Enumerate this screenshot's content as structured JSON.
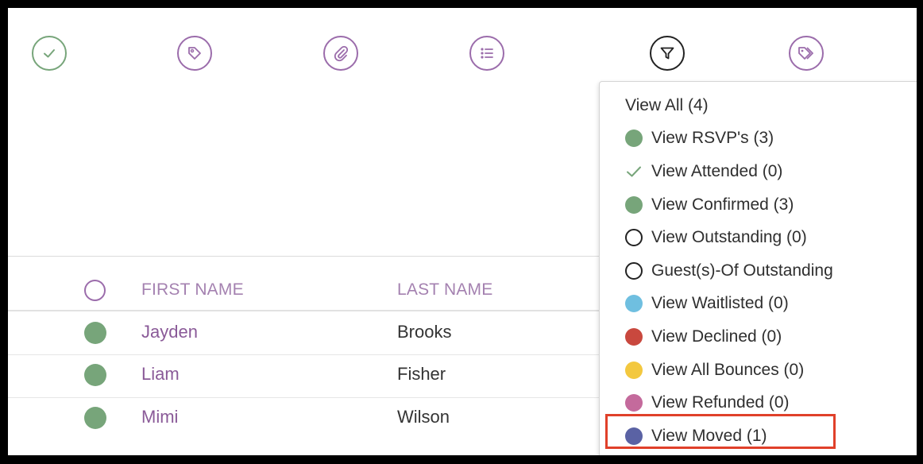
{
  "toolbar": {
    "icons": [
      {
        "name": "check-circle-icon",
        "color": "#77a57a"
      },
      {
        "name": "tag-icon",
        "color": "#9b6cab"
      },
      {
        "name": "paperclip-icon",
        "color": "#9b6cab"
      },
      {
        "name": "list-icon",
        "color": "#9b6cab"
      },
      {
        "name": "filter-icon",
        "color": "#222222"
      },
      {
        "name": "tags-icon",
        "color": "#9b6cab"
      }
    ]
  },
  "table": {
    "headers": {
      "first_name": "FIRST NAME",
      "last_name": "LAST NAME"
    },
    "rows": [
      {
        "first": "Jayden",
        "last": "Brooks",
        "status_color": "#77a57a"
      },
      {
        "first": "Liam",
        "last": "Fisher",
        "status_color": "#77a57a"
      },
      {
        "first": "Mimi",
        "last": "Wilson",
        "status_color": "#77a57a"
      }
    ]
  },
  "filter_menu": {
    "items": [
      {
        "label": "View All (4)",
        "marker": "none"
      },
      {
        "label": "View RSVP's (3)",
        "marker": "dot",
        "color": "#77a57a"
      },
      {
        "label": "View Attended (0)",
        "marker": "check",
        "color": "#77a57a"
      },
      {
        "label": "View Confirmed (3)",
        "marker": "dot",
        "color": "#77a57a"
      },
      {
        "label": "View Outstanding (0)",
        "marker": "open-circle"
      },
      {
        "label": "Guest(s)-Of Outstanding",
        "marker": "open-circle"
      },
      {
        "label": "View Waitlisted (0)",
        "marker": "dot",
        "color": "#6fbfe0"
      },
      {
        "label": "View Declined (0)",
        "marker": "dot",
        "color": "#c9483e"
      },
      {
        "label": "View All Bounces (0)",
        "marker": "dot",
        "color": "#f3c83f"
      },
      {
        "label": "View Refunded (0)",
        "marker": "dot",
        "color": "#c46a9c"
      },
      {
        "label": "View Moved (1)",
        "marker": "dot",
        "color": "#5a62a4"
      }
    ],
    "highlighted_item": "View Moved (1)",
    "highlight_color": "#e0402a"
  }
}
